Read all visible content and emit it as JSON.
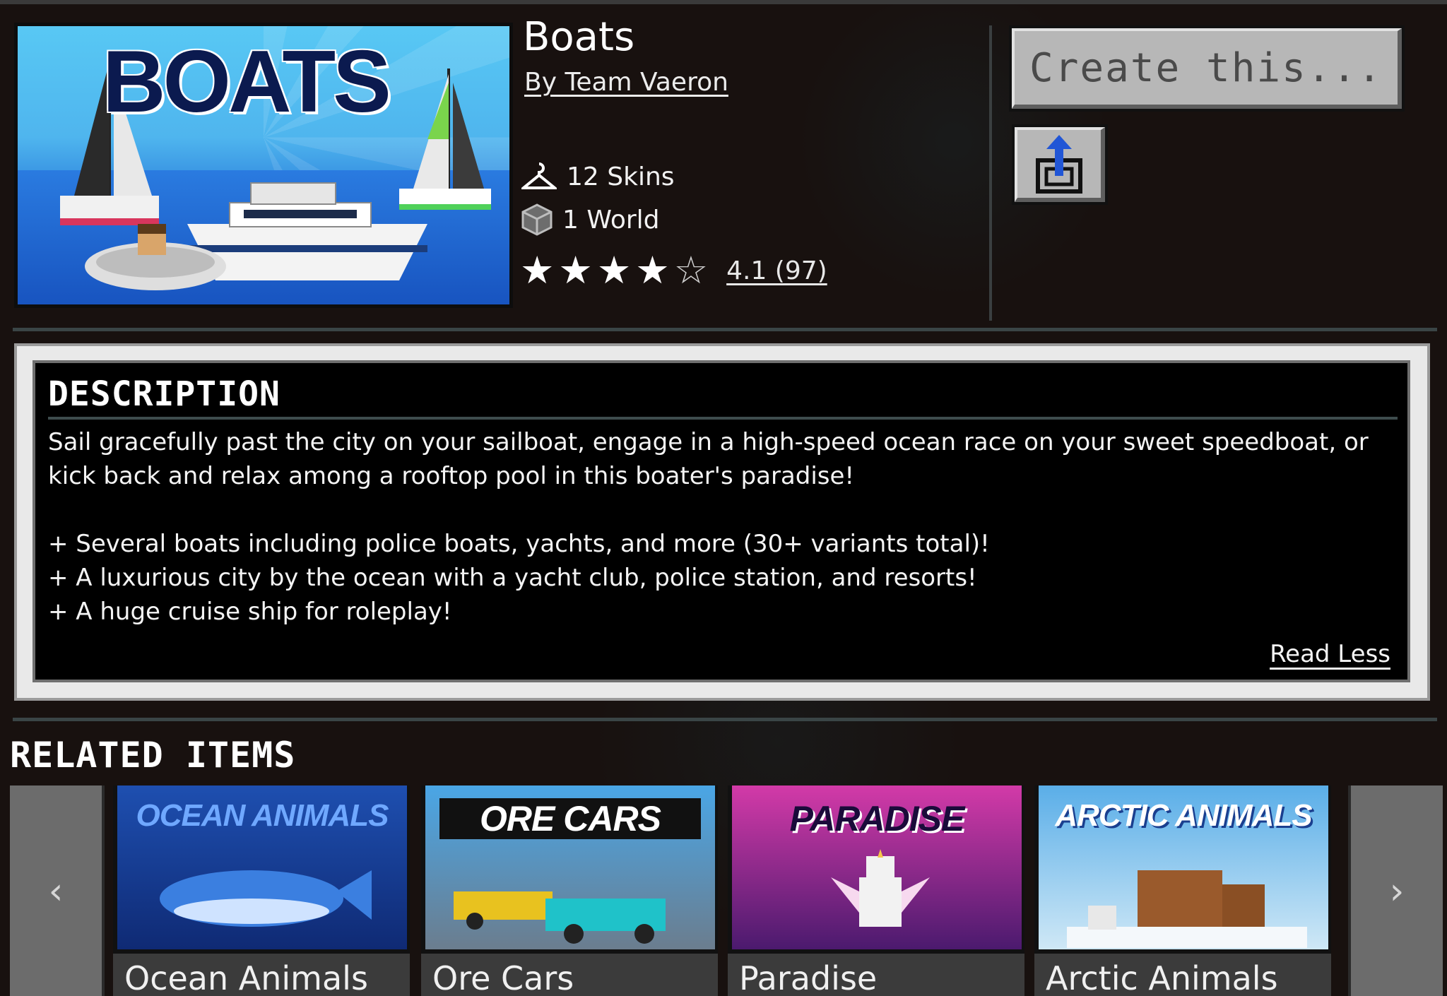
{
  "product": {
    "title": "Boats",
    "author": "By Team Vaeron",
    "hero_logo_text": "BOATS",
    "skins": "12 Skins",
    "worlds": "1 World",
    "rating_stars": 4,
    "rating_max": 5,
    "rating_text": "4.1 (97)"
  },
  "actions": {
    "create_label": "Create this..."
  },
  "description": {
    "heading": "DESCRIPTION",
    "paragraph": "Sail gracefully past the city on your sailboat, engage in a high-speed ocean race on your sweet speedboat, or kick back and relax among a rooftop pool in this boater's paradise!",
    "bullets": [
      "+ Several boats including police boats, yachts, and more (30+ variants total)!",
      "+ A luxurious city by the ocean with a yacht club, police station, and resorts!",
      "+ A huge cruise ship for roleplay!"
    ],
    "toggle_label": "Read Less"
  },
  "related": {
    "heading": "RELATED ITEMS",
    "prev_glyph": "‹",
    "next_glyph": "›",
    "items": [
      {
        "label": "Ocean Animals",
        "art_text": "OCEAN ANIMALS",
        "color_top": "#1e4fb0",
        "color_bottom": "#0f2a74"
      },
      {
        "label": "Ore Cars",
        "art_text": "ORE CARS",
        "color_top": "#4aa6e6",
        "color_bottom": "#6b7d8e"
      },
      {
        "label": "Paradise",
        "art_text": "PARADISE",
        "color_top": "#d33aa8",
        "color_bottom": "#4b1a6e"
      },
      {
        "label": "Arctic Animals",
        "art_text": "ARCTIC ANIMALS",
        "color_top": "#5aaee8",
        "color_bottom": "#cfe8f6"
      }
    ]
  }
}
